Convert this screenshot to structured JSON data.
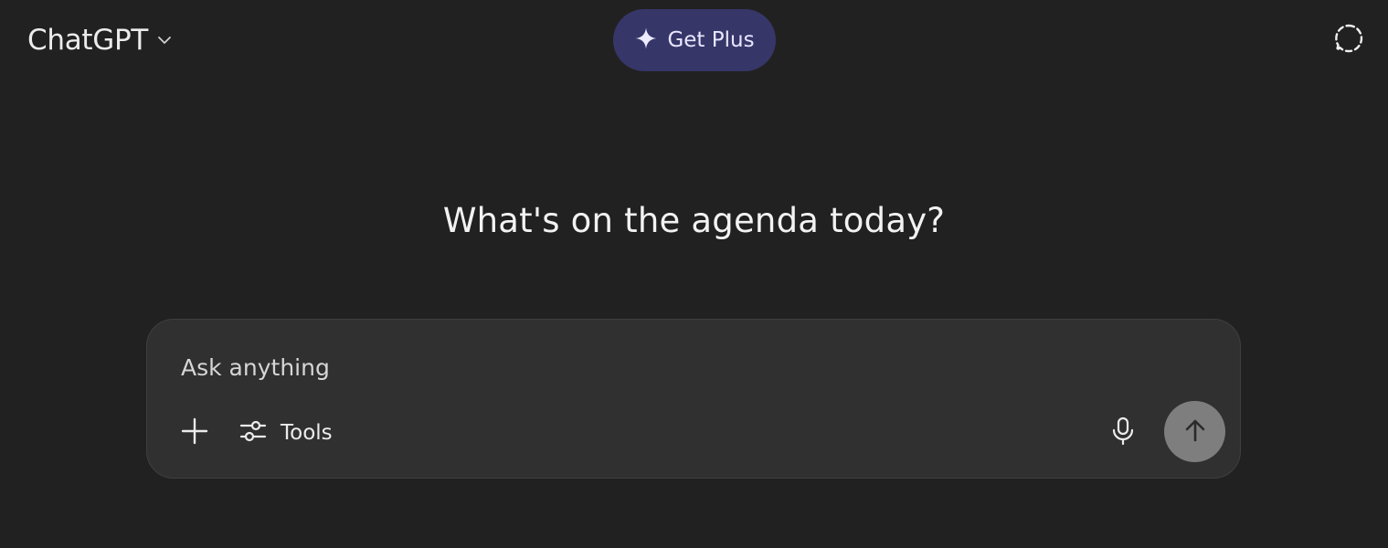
{
  "header": {
    "model_name": "ChatGPT",
    "upgrade_label": "Get Plus",
    "icons": {
      "model_dropdown": "chevron-down-icon",
      "upgrade": "sparkle-icon",
      "temporary_chat": "temporary-chat-icon"
    }
  },
  "main": {
    "headline": "What's on the agenda today?"
  },
  "composer": {
    "placeholder": "Ask anything",
    "value": "",
    "tools_label": "Tools",
    "icons": {
      "attach": "plus-icon",
      "tools": "sliders-icon",
      "voice": "microphone-icon",
      "send": "arrow-up-icon"
    }
  },
  "colors": {
    "background": "#212121",
    "composer_background": "#303030",
    "upgrade_pill": "#373669",
    "send_button": "#7e7e7e",
    "text": "#ececec"
  }
}
